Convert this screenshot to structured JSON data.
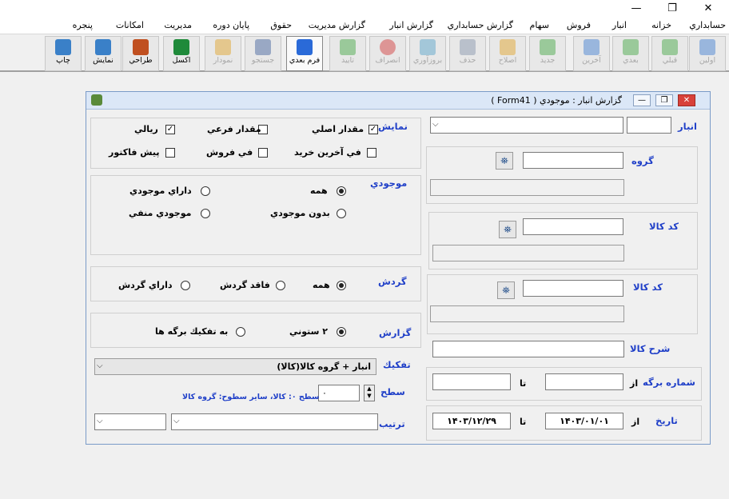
{
  "window": {
    "minimize": "—",
    "restore": "❐",
    "close": "✕"
  },
  "menu": [
    "حسابداري",
    "خزانه",
    "انبار",
    "فروش",
    "سهام",
    "گزارش حسابداري",
    "گزارش انبار",
    "گزارش مديريت",
    "حقوق",
    "پايان دوره",
    "مديريت",
    "امكانات",
    "پنجره"
  ],
  "toolbar": [
    {
      "label": "اولين",
      "icon": "arrow-up-icon",
      "enabled": false
    },
    {
      "label": "قبلي",
      "icon": "arrow-right-icon",
      "enabled": false
    },
    {
      "label": "بعدي",
      "icon": "arrow-left-icon",
      "enabled": false
    },
    {
      "label": "آخرين",
      "icon": "arrow-down-icon",
      "enabled": false
    },
    {
      "label": "جديد",
      "icon": "plus-icon",
      "enabled": false
    },
    {
      "label": "اصلاح",
      "icon": "pencil-icon",
      "enabled": false
    },
    {
      "label": "حذف",
      "icon": "trash-icon",
      "enabled": false
    },
    {
      "label": "بروزآوري",
      "icon": "refresh-icon",
      "enabled": false
    },
    {
      "label": "انصراف",
      "icon": "cancel-icon",
      "enabled": false
    },
    {
      "label": "تاييد",
      "icon": "check-icon",
      "enabled": false
    },
    {
      "label": "فرم بعدي",
      "icon": "monitor-icon",
      "enabled": true
    },
    {
      "label": "جستجو",
      "icon": "binoculars-icon",
      "enabled": false
    },
    {
      "label": "نمودار",
      "icon": "chart-icon",
      "enabled": false
    },
    {
      "label": "اكسل",
      "icon": "excel-icon",
      "enabled": true
    },
    {
      "label": "طراحي",
      "icon": "brush-icon",
      "enabled": true
    },
    {
      "label": "نمايش",
      "icon": "preview-icon",
      "enabled": true
    },
    {
      "label": "چاپ",
      "icon": "printer-icon",
      "enabled": true
    }
  ],
  "form": {
    "title": "گزارش انبار : موجودي ( Form41 )",
    "anbar_label": "انبار",
    "anbar_code": "",
    "anbar_name": "",
    "group_label": "گروه",
    "group_code": "",
    "group_name": "",
    "item_code_label_1": "كد كالا",
    "item_code_1": "",
    "item_name_1": "",
    "item_code_label_2": "كد كالا",
    "item_code_2": "",
    "item_name_2": "",
    "item_desc_label": "شرح كالا",
    "item_desc": "",
    "sheet_no_label": "شماره برگه",
    "from_label": "از",
    "to_label": "تا",
    "sheet_from": "",
    "sheet_to": "",
    "date_label": "تاريخ",
    "date_from": "۱۴۰۳/۰۱/۰۱",
    "date_to": "۱۴۰۳/۱۲/۲۹",
    "display": {
      "label": "نمايش",
      "options": [
        {
          "text": "مقدار اصلي",
          "checked": true
        },
        {
          "text": "مقدار فرعي",
          "checked": false
        },
        {
          "text": "ريالي",
          "checked": true
        },
        {
          "text": "في آخرين خريد",
          "checked": false
        },
        {
          "text": "في فروش",
          "checked": false
        },
        {
          "text": "پيش فاكتور",
          "checked": false
        }
      ]
    },
    "stock": {
      "label": "موجودي",
      "options": [
        {
          "text": "همه",
          "selected": true
        },
        {
          "text": "داراي موجودي",
          "selected": false
        },
        {
          "text": "بدون موجودي",
          "selected": false
        },
        {
          "text": "موجودي منفي",
          "selected": false
        }
      ]
    },
    "turnover": {
      "label": "گردش",
      "options": [
        {
          "text": "همه",
          "selected": true
        },
        {
          "text": "فاقد گردش",
          "selected": false
        },
        {
          "text": "داراي گردش",
          "selected": false
        }
      ]
    },
    "report": {
      "label": "گزارش",
      "options": [
        {
          "text": "۲ ستوني",
          "selected": true
        },
        {
          "text": "به تفكيك برگه ها",
          "selected": false
        }
      ]
    },
    "breakdown_label": "تفكيك",
    "breakdown_value": "انبار + گروه كالا(كالا)",
    "level_label": "سطح",
    "level_value": "۰",
    "level_hint": "سطح ۰: كالا، ساير سطوح: گروه كالا",
    "order_label": "ترتيب",
    "order_value": "",
    "order_dir": ""
  }
}
